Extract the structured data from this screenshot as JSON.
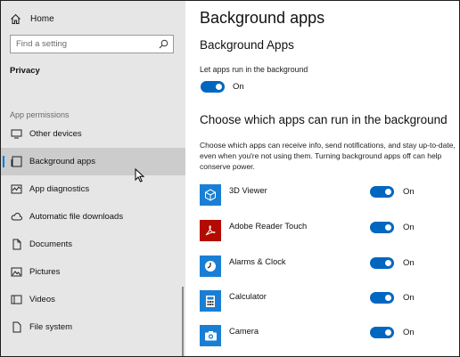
{
  "sidebar": {
    "home_label": "Home",
    "search_placeholder": "Find a setting",
    "section_title": "Privacy",
    "group_label": "App permissions",
    "items": [
      {
        "label": "Other devices",
        "icon": "other-devices-icon"
      },
      {
        "label": "Background apps",
        "icon": "background-apps-icon",
        "selected": true
      },
      {
        "label": "App diagnostics",
        "icon": "app-diagnostics-icon"
      },
      {
        "label": "Automatic file downloads",
        "icon": "cloud-icon"
      },
      {
        "label": "Documents",
        "icon": "document-icon"
      },
      {
        "label": "Pictures",
        "icon": "pictures-icon"
      },
      {
        "label": "Videos",
        "icon": "videos-icon"
      },
      {
        "label": "File system",
        "icon": "file-system-icon"
      }
    ]
  },
  "main": {
    "page_title": "Background apps",
    "section1_title": "Background Apps",
    "let_apps_label": "Let apps run in the background",
    "master_toggle": {
      "state_label": "On",
      "on": true
    },
    "section2_title": "Choose which apps can run in the background",
    "description": "Choose which apps can receive info, send notifications, and stay up-to-date, even when you're not using them. Turning background apps off can help conserve power.",
    "apps": [
      {
        "name": "3D Viewer",
        "icon": "3d-viewer-icon",
        "icon_color": "#1a7fd4",
        "state_label": "On",
        "on": true
      },
      {
        "name": "Adobe Reader Touch",
        "icon": "adobe-reader-icon",
        "icon_color": "#b30b00",
        "state_label": "On",
        "on": true
      },
      {
        "name": "Alarms & Clock",
        "icon": "alarm-clock-icon",
        "icon_color": "#1a7fd4",
        "state_label": "On",
        "on": true
      },
      {
        "name": "Calculator",
        "icon": "calculator-icon",
        "icon_color": "#1a7fd4",
        "state_label": "On",
        "on": true
      },
      {
        "name": "Camera",
        "icon": "camera-icon",
        "icon_color": "#1a7fd4",
        "state_label": "On",
        "on": true
      }
    ]
  },
  "colors": {
    "accent": "#0067c0",
    "sidebar_bg": "#e6e6e6",
    "selected_bg": "#cccccc"
  }
}
